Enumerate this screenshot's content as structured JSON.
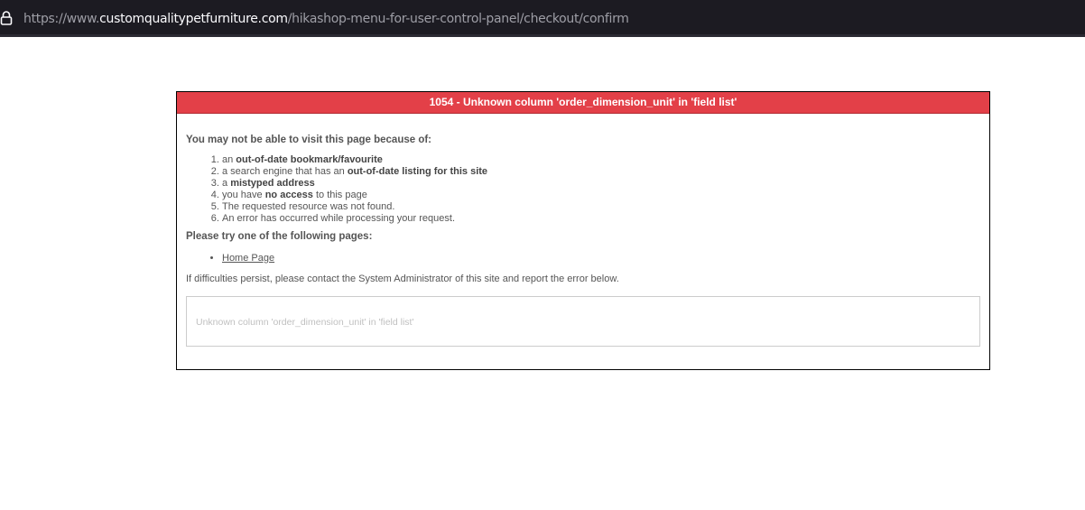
{
  "browser": {
    "url_prefix": "https://www.",
    "url_domain": "customqualitypetfurniture.com",
    "url_path": "/hikashop-menu-for-user-control-panel/checkout/confirm"
  },
  "error": {
    "title": "1054 - Unknown column 'order_dimension_unit' in 'field list'",
    "reasons_heading": "You may not be able to visit this page because of:",
    "reasons": [
      {
        "pre": "an ",
        "bold": "out-of-date bookmark/favourite",
        "post": ""
      },
      {
        "pre": "a search engine that has an ",
        "bold": "out-of-date listing for this site",
        "post": ""
      },
      {
        "pre": "a ",
        "bold": "mistyped address",
        "post": ""
      },
      {
        "pre": "you have ",
        "bold": "no access",
        "post": " to this page"
      },
      {
        "pre": "The requested resource was not found.",
        "bold": "",
        "post": ""
      },
      {
        "pre": "An error has occurred while processing your request.",
        "bold": "",
        "post": ""
      }
    ],
    "try_heading": "Please try one of the following pages:",
    "home_link": "Home Page",
    "persist_text": "If difficulties persist, please contact the System Administrator of this site and report the error below.",
    "detail": "Unknown column 'order_dimension_unit' in 'field list'"
  }
}
